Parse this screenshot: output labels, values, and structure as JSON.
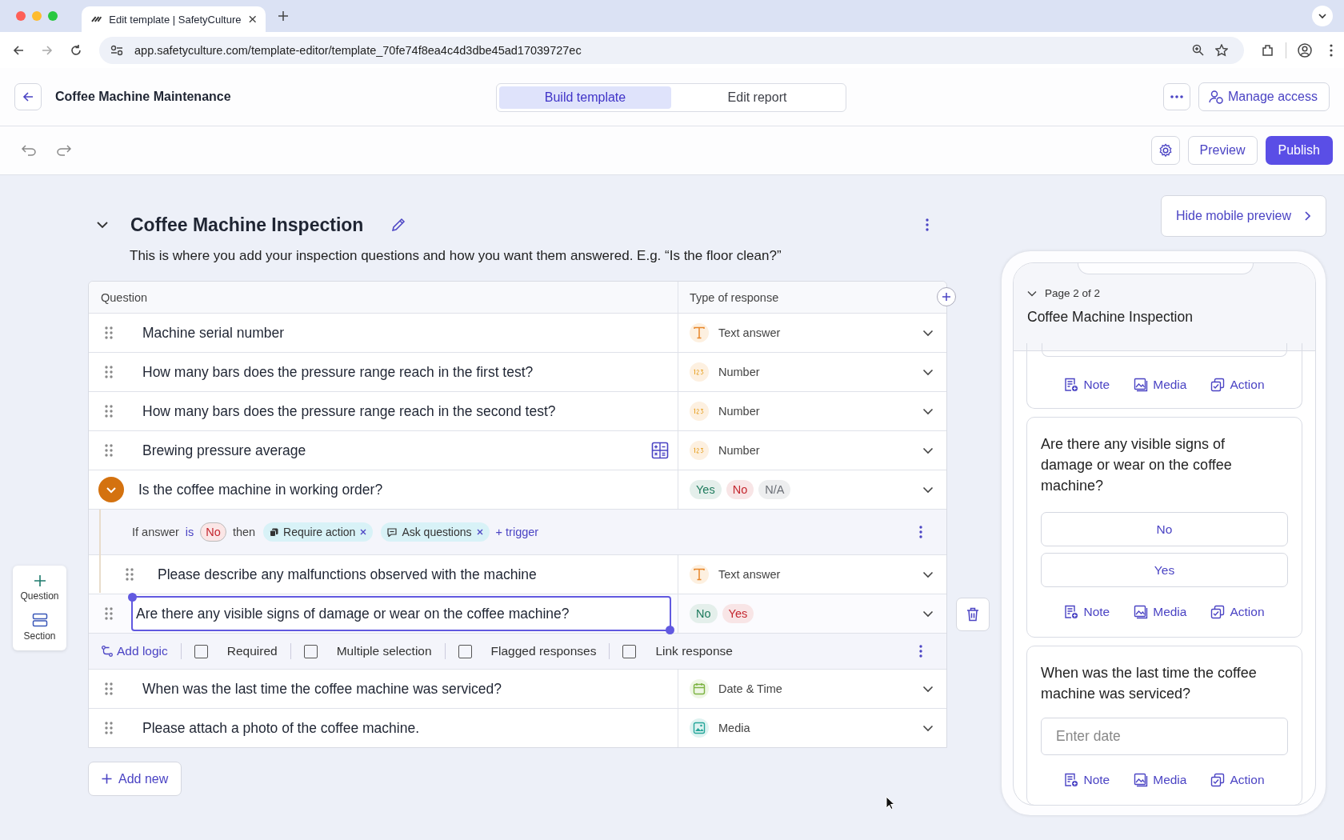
{
  "browser": {
    "tab_title": "Edit template | SafetyCulture",
    "url": "app.safetyculture.com/template-editor/template_70fe74f8ea4c4d3dbe45ad17039727ec"
  },
  "header": {
    "title": "Coffee Machine Maintenance",
    "tabs": [
      {
        "label": "Build template",
        "selected": true
      },
      {
        "label": "Edit report",
        "selected": false
      }
    ],
    "manage_access": "Manage access"
  },
  "toolbar": {
    "preview": "Preview",
    "publish": "Publish"
  },
  "insert_panel": [
    {
      "kind": "question",
      "label": "Question"
    },
    {
      "kind": "section",
      "label": "Section"
    }
  ],
  "section": {
    "title": "Coffee Machine Inspection",
    "description": "This is where you add your inspection questions and how you want them answered. E.g. “Is the floor clean?”",
    "columns": [
      "Question",
      "Type of response"
    ],
    "rows": [
      {
        "question": "Machine serial number",
        "selected": false,
        "formula": false,
        "response": {
          "kind": "text",
          "label": "Text answer"
        }
      },
      {
        "question": "How many bars does the pressure range reach in the first test?",
        "selected": false,
        "formula": false,
        "response": {
          "kind": "number",
          "label": "Number"
        }
      },
      {
        "question": "How many bars does the pressure range reach in the second test?",
        "selected": false,
        "formula": false,
        "response": {
          "kind": "number",
          "label": "Number"
        }
      },
      {
        "question": "Brewing pressure average",
        "selected": false,
        "formula": true,
        "response": {
          "kind": "number",
          "label": "Number"
        }
      },
      {
        "question": "Is the coffee machine in working order?",
        "selected": false,
        "formula": false,
        "response": {
          "kind": "choices",
          "choices": [
            {
              "label": "Yes",
              "color": "#1d7a5c"
            },
            {
              "label": "No",
              "color": "#c4262e"
            },
            {
              "label": "N/A",
              "color": "#6b6f76"
            }
          ]
        },
        "logic": {
          "prefix": "If answer",
          "operator": "is",
          "value": "No",
          "then": "then",
          "triggers": [
            {
              "kind": "action",
              "label": "Require action"
            },
            {
              "kind": "questions",
              "label": "Ask questions"
            }
          ],
          "add_trigger": "+ trigger",
          "children": [
            {
              "question": "Please describe any malfunctions observed with the machine",
              "selected": false,
              "formula": false,
              "response": {
                "kind": "text",
                "label": "Text answer"
              }
            }
          ]
        }
      },
      {
        "question": "Are there any visible signs of damage or wear on the coffee machine?",
        "selected": true,
        "formula": false,
        "response": {
          "kind": "choices",
          "choices": [
            {
              "label": "No",
              "color": "#1d7a5c"
            },
            {
              "label": "Yes",
              "color": "#c4262e"
            }
          ]
        },
        "options": {
          "add_logic": "Add logic",
          "checkboxes": [
            {
              "label": "Required",
              "checked": false
            },
            {
              "label": "Multiple selection",
              "checked": false
            },
            {
              "label": "Flagged responses",
              "checked": false
            },
            {
              "label": "Link response",
              "checked": false
            }
          ]
        }
      },
      {
        "question": "When was the last time the coffee machine was serviced?",
        "selected": false,
        "formula": false,
        "response": {
          "kind": "date",
          "label": "Date & Time"
        }
      },
      {
        "question": "Please attach a photo of the coffee machine.",
        "selected": false,
        "formula": false,
        "response": {
          "kind": "media",
          "label": "Media"
        }
      }
    ],
    "add_new": "Add new"
  },
  "preview": {
    "hide_label": "Hide mobile preview",
    "page_label": "Page 2 of 2",
    "title": "Coffee Machine Inspection",
    "cards": [
      {
        "kind": "partial",
        "actions": [
          {
            "kind": "note",
            "label": "Note"
          },
          {
            "kind": "media",
            "label": "Media"
          },
          {
            "kind": "action",
            "label": "Action"
          }
        ]
      },
      {
        "kind": "choice",
        "question": "Are there any visible signs of damage or wear on the coffee machine?",
        "options": [
          "No",
          "Yes"
        ],
        "actions": [
          {
            "kind": "note",
            "label": "Note"
          },
          {
            "kind": "media",
            "label": "Media"
          },
          {
            "kind": "action",
            "label": "Action"
          }
        ]
      },
      {
        "kind": "date",
        "question": "When was the last time the coffee machine was serviced?",
        "placeholder": "Enter date",
        "actions": [
          {
            "kind": "note",
            "label": "Note"
          },
          {
            "kind": "media",
            "label": "Media"
          },
          {
            "kind": "action",
            "label": "Action"
          }
        ]
      }
    ]
  }
}
